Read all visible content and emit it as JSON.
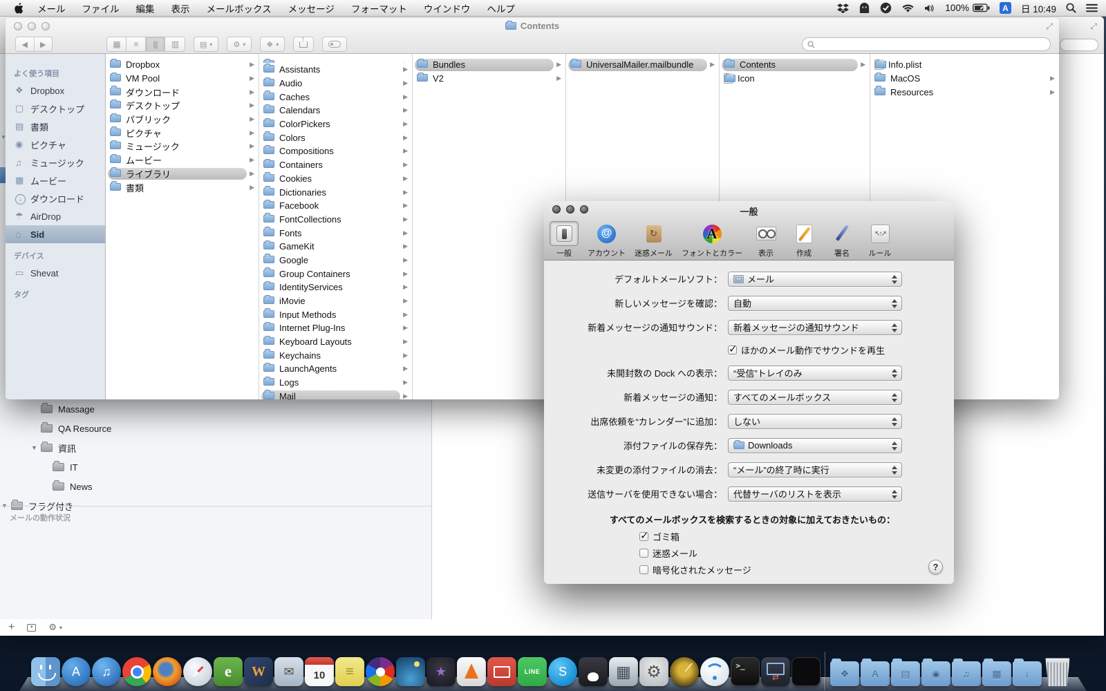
{
  "menu_bar": {
    "menus": [
      "メール",
      "ファイル",
      "編集",
      "表示",
      "メールボックス",
      "メッセージ",
      "フォーマット",
      "ウインドウ",
      "ヘルプ"
    ],
    "status": {
      "battery": "100%",
      "input": "A",
      "clock": "日 10:49"
    }
  },
  "finder": {
    "title": "Contents",
    "sidebar": {
      "fav_header": "よく使う項目",
      "fav_items": [
        {
          "label": "Dropbox",
          "icon": "dropbox-icon"
        },
        {
          "label": "デスクトップ",
          "icon": "desktop-icon"
        },
        {
          "label": "書類",
          "icon": "documents-icon"
        },
        {
          "label": "ピクチャ",
          "icon": "pictures-icon"
        },
        {
          "label": "ミュージック",
          "icon": "music-icon"
        },
        {
          "label": "ムービー",
          "icon": "movies-icon"
        },
        {
          "label": "ダウンロード",
          "icon": "downloads-icon"
        },
        {
          "label": "AirDrop",
          "icon": "airdrop-icon"
        },
        {
          "label": "Sid",
          "icon": "home-icon",
          "selected": true
        }
      ],
      "dev_header": "デバイス",
      "dev_items": [
        {
          "label": "Shevat",
          "icon": "laptop-icon"
        }
      ],
      "tag_header": "タグ"
    },
    "columns": [
      {
        "items": [
          {
            "label": "Dropbox",
            "icon": "folder",
            "arrow": true
          },
          {
            "label": "VM Pool",
            "icon": "folder",
            "arrow": true
          },
          {
            "label": "ダウンロード",
            "icon": "folder",
            "arrow": true
          },
          {
            "label": "デスクトップ",
            "icon": "folder",
            "arrow": true
          },
          {
            "label": "パブリック",
            "icon": "folder",
            "arrow": true
          },
          {
            "label": "ピクチャ",
            "icon": "folder",
            "arrow": true
          },
          {
            "label": "ミュージック",
            "icon": "folder",
            "arrow": true
          },
          {
            "label": "ムービー",
            "icon": "folder",
            "arrow": true
          },
          {
            "label": "ライブラリ",
            "icon": "folder",
            "arrow": true,
            "selected": true
          },
          {
            "label": "書類",
            "icon": "folder",
            "arrow": true
          }
        ]
      },
      {
        "items": [
          {
            "label": "",
            "icon": "folder",
            "arrow": true,
            "partial": true
          },
          {
            "label": "Assistants",
            "icon": "folder",
            "arrow": true
          },
          {
            "label": "Audio",
            "icon": "folder",
            "arrow": true
          },
          {
            "label": "Caches",
            "icon": "folder",
            "arrow": true
          },
          {
            "label": "Calendars",
            "icon": "folder",
            "arrow": true
          },
          {
            "label": "ColorPickers",
            "icon": "folder",
            "arrow": true
          },
          {
            "label": "Colors",
            "icon": "folder",
            "arrow": true
          },
          {
            "label": "Compositions",
            "icon": "folder",
            "arrow": true
          },
          {
            "label": "Containers",
            "icon": "folder",
            "arrow": true
          },
          {
            "label": "Cookies",
            "icon": "folder",
            "arrow": true
          },
          {
            "label": "Dictionaries",
            "icon": "folder",
            "arrow": true
          },
          {
            "label": "Facebook",
            "icon": "folder",
            "arrow": true
          },
          {
            "label": "FontCollections",
            "icon": "folder",
            "arrow": true
          },
          {
            "label": "Fonts",
            "icon": "folder",
            "arrow": true
          },
          {
            "label": "GameKit",
            "icon": "folder",
            "arrow": true
          },
          {
            "label": "Google",
            "icon": "folder",
            "arrow": true
          },
          {
            "label": "Group Containers",
            "icon": "folder",
            "arrow": true
          },
          {
            "label": "IdentityServices",
            "icon": "folder",
            "arrow": true
          },
          {
            "label": "iMovie",
            "icon": "folder",
            "arrow": true
          },
          {
            "label": "Input Methods",
            "icon": "folder",
            "arrow": true
          },
          {
            "label": "Internet Plug-Ins",
            "icon": "folder",
            "arrow": true
          },
          {
            "label": "Keyboard Layouts",
            "icon": "folder",
            "arrow": true
          },
          {
            "label": "Keychains",
            "icon": "folder",
            "arrow": true
          },
          {
            "label": "LaunchAgents",
            "icon": "folder",
            "arrow": true
          },
          {
            "label": "Logs",
            "icon": "folder",
            "arrow": true
          },
          {
            "label": "Mail",
            "icon": "folder",
            "arrow": true,
            "selected": true
          }
        ]
      },
      {
        "items": [
          {
            "label": "Bundles",
            "icon": "folder",
            "arrow": true,
            "selected": true
          },
          {
            "label": "V2",
            "icon": "folder",
            "arrow": true
          }
        ]
      },
      {
        "items": [
          {
            "label": "UniversalMailer.mailbundle",
            "icon": "folder",
            "arrow": true,
            "selected": true
          }
        ]
      },
      {
        "items": [
          {
            "label": "Contents",
            "icon": "folder",
            "arrow": true,
            "selected": true
          },
          {
            "label": "Icon",
            "icon": "file",
            "arrow": false
          }
        ]
      },
      {
        "items": [
          {
            "label": "Info.plist",
            "icon": "plist",
            "arrow": false
          },
          {
            "label": "MacOS",
            "icon": "folder",
            "arrow": true
          },
          {
            "label": "Resources",
            "icon": "folder",
            "arrow": true
          }
        ]
      }
    ]
  },
  "mail_prefs": {
    "title": "一般",
    "toolbar": [
      {
        "label": "一般",
        "selected": true
      },
      {
        "label": "アカウント"
      },
      {
        "label": "迷惑メール"
      },
      {
        "label": "フォントとカラー"
      },
      {
        "label": "表示"
      },
      {
        "label": "作成"
      },
      {
        "label": "署名"
      },
      {
        "label": "ルール"
      }
    ],
    "rows": [
      {
        "label": "デフォルトメールソフト：",
        "value": "メール",
        "icon": "mail-app-icon"
      },
      {
        "label": "新しいメッセージを確認：",
        "value": "自動"
      },
      {
        "label": "新着メッセージの通知サウンド：",
        "value": "新着メッセージの通知サウンド"
      },
      {
        "type": "checkbox",
        "label": "ほかのメール動作でサウンドを再生",
        "checked": true
      },
      {
        "label": "未開封数の Dock への表示：",
        "value": "“受信”トレイのみ"
      },
      {
        "label": "新着メッセージの通知：",
        "value": "すべてのメールボックス"
      },
      {
        "label": "出席依頼を“カレンダー”に追加：",
        "value": "しない"
      },
      {
        "label": "添付ファイルの保存先：",
        "value": "Downloads",
        "icon": "folder-icon"
      },
      {
        "label": "未変更の添付ファイルの消去：",
        "value": "“メール”の終了時に実行"
      },
      {
        "label": "送信サーバを使用できない場合：",
        "value": "代替サーバのリストを表示"
      }
    ],
    "scope_label": "すべてのメールボックスを検索するときの対象に加えておきたいもの：",
    "scope_options": [
      {
        "label": "ゴミ箱",
        "checked": true
      },
      {
        "label": "迷惑メール",
        "checked": false
      },
      {
        "label": "暗号化されたメッセージ",
        "checked": false
      }
    ],
    "help": "?"
  },
  "mail_window": {
    "sidebar_items": [
      {
        "label": "Massage",
        "indent": 2,
        "icon": "folder"
      },
      {
        "label": "QA Resource",
        "indent": 2,
        "icon": "folder"
      },
      {
        "label": "資訊",
        "indent": 2,
        "icon": "folder",
        "disclosure": "open"
      },
      {
        "label": "IT",
        "indent": 3,
        "icon": "folder"
      },
      {
        "label": "News",
        "indent": 3,
        "icon": "folder"
      },
      {
        "label": "フラグ付き",
        "indent": 0,
        "icon": "flag",
        "disclosure": "open"
      }
    ],
    "status_header": "メールの動作状況"
  },
  "dock": {
    "items": [
      {
        "name": "finder",
        "shape": "square",
        "glyph": "",
        "bg": "linear-gradient(90deg,#8fc1ea 50%,#5e95cd 50%)"
      },
      {
        "name": "app-store",
        "shape": "circle",
        "glyph": "A",
        "bg": "radial-gradient(circle at 35% 30%,#66aee8,#1a62b4)"
      },
      {
        "name": "itunes",
        "shape": "circle",
        "glyph": "♫",
        "bg": "radial-gradient(circle at 35% 30%,#6fb8f2,#1c59a8)"
      },
      {
        "name": "chrome",
        "shape": "circle",
        "glyph": "",
        "bg": ""
      },
      {
        "name": "firefox",
        "shape": "circle",
        "glyph": "",
        "bg": "radial-gradient(circle at 45% 42%,#4f7fc4 0 26%,#f0a030 40%,#e06818 70%,#c45510)"
      },
      {
        "name": "safari",
        "shape": "circle",
        "glyph": "",
        "bg": "radial-gradient(circle at 40% 35%,#fafcfe,#bac6d2)"
      },
      {
        "name": "evernote",
        "shape": "square",
        "glyph": "e",
        "bg": "linear-gradient(#6cb54e,#478c30)"
      },
      {
        "name": "wunderlist",
        "shape": "square",
        "glyph": "W",
        "bg": "linear-gradient(135deg,#32486e,#1e2c48)",
        "fg": "#e8a33d"
      },
      {
        "name": "mail",
        "shape": "square",
        "glyph": "✉",
        "bg": "linear-gradient(#d8e0ea,#a4b4c6)",
        "fg": "#5d4e3e"
      },
      {
        "name": "calendar",
        "shape": "square",
        "glyph": "10",
        "bg": "#f8f8f8",
        "fg": "#333333"
      },
      {
        "name": "stickies",
        "shape": "square",
        "glyph": "≡",
        "bg": "linear-gradient(#f2e98c,#e2cf52)",
        "fg": "#9a8c2a"
      },
      {
        "name": "picasa",
        "shape": "circle",
        "glyph": "",
        "bg": ""
      },
      {
        "name": "iphoto",
        "shape": "square",
        "glyph": "",
        "bg": "radial-gradient(circle at 50% 75%,#49a0d5,#123d63)"
      },
      {
        "name": "imovie",
        "shape": "square",
        "glyph": "★",
        "bg": "radial-gradient(circle at 50% 40%,#3a3a46,#17171f)",
        "fg": "#a06ad4"
      },
      {
        "name": "vlc",
        "shape": "square",
        "glyph": "",
        "bg": "linear-gradient(#fafafa,#d8d8d8)"
      },
      {
        "name": "remote-desktop",
        "shape": "square",
        "glyph": "",
        "bg": "linear-gradient(#e2574c,#b93a2c)"
      },
      {
        "name": "line",
        "shape": "square",
        "glyph": "LINE",
        "bg": "linear-gradient(#4cc764,#2faa44)",
        "fg": "#ffffff"
      },
      {
        "name": "skype",
        "shape": "circle",
        "glyph": "S",
        "bg": "radial-gradient(circle at 35% 30%,#5ec8f5,#0078ca)"
      },
      {
        "name": "qq-penguin",
        "shape": "square",
        "glyph": "",
        "bg": "linear-gradient(#3a3a42,#191920)"
      },
      {
        "name": "calculator",
        "shape": "square",
        "glyph": "▦",
        "bg": "linear-gradient(#e8ecf0,#9ba6b0)",
        "fg": "#44505c"
      },
      {
        "name": "system-preferences",
        "shape": "square",
        "glyph": "⚙",
        "bg": "radial-gradient(circle at 50% 35%,#ececec,#b0b6bc)",
        "fg": "#555555"
      },
      {
        "name": "radar",
        "shape": "circle",
        "glyph": "",
        "bg": "radial-gradient(circle at 50% 45%,#d8b23a 0 30%,#6b5513 70%,#3a2f0c)"
      },
      {
        "name": "airport-utility",
        "shape": "circle",
        "glyph": "",
        "bg": "radial-gradient(circle at 40% 35%,#ffffff,#d4dde4)"
      },
      {
        "name": "terminal",
        "shape": "square",
        "glyph": ">_",
        "bg": "linear-gradient(#2a2a2a,#0c0c0c)",
        "fg": "#cfe8cf"
      },
      {
        "name": "screen-share",
        "shape": "square",
        "glyph": "⇄",
        "bg": "linear-gradient(#39404e,#1d222c)"
      },
      {
        "name": "black-window",
        "shape": "square",
        "glyph": "",
        "bg": "#0b0b0d"
      },
      {
        "name": "dock-separator",
        "shape": "separator",
        "glyph": ""
      },
      {
        "name": "folder-dropbox",
        "shape": "folder",
        "glyph": "❖"
      },
      {
        "name": "folder-applications",
        "shape": "folder",
        "glyph": "A"
      },
      {
        "name": "folder-documents",
        "shape": "folder",
        "glyph": "▤"
      },
      {
        "name": "folder-pictures",
        "shape": "folder",
        "glyph": "◉"
      },
      {
        "name": "folder-music",
        "shape": "folder",
        "glyph": "♫"
      },
      {
        "name": "folder-movies",
        "shape": "folder",
        "glyph": "▦"
      },
      {
        "name": "folder-downloads",
        "shape": "folder",
        "glyph": "↓"
      },
      {
        "name": "trash",
        "shape": "trash",
        "glyph": ""
      }
    ]
  }
}
